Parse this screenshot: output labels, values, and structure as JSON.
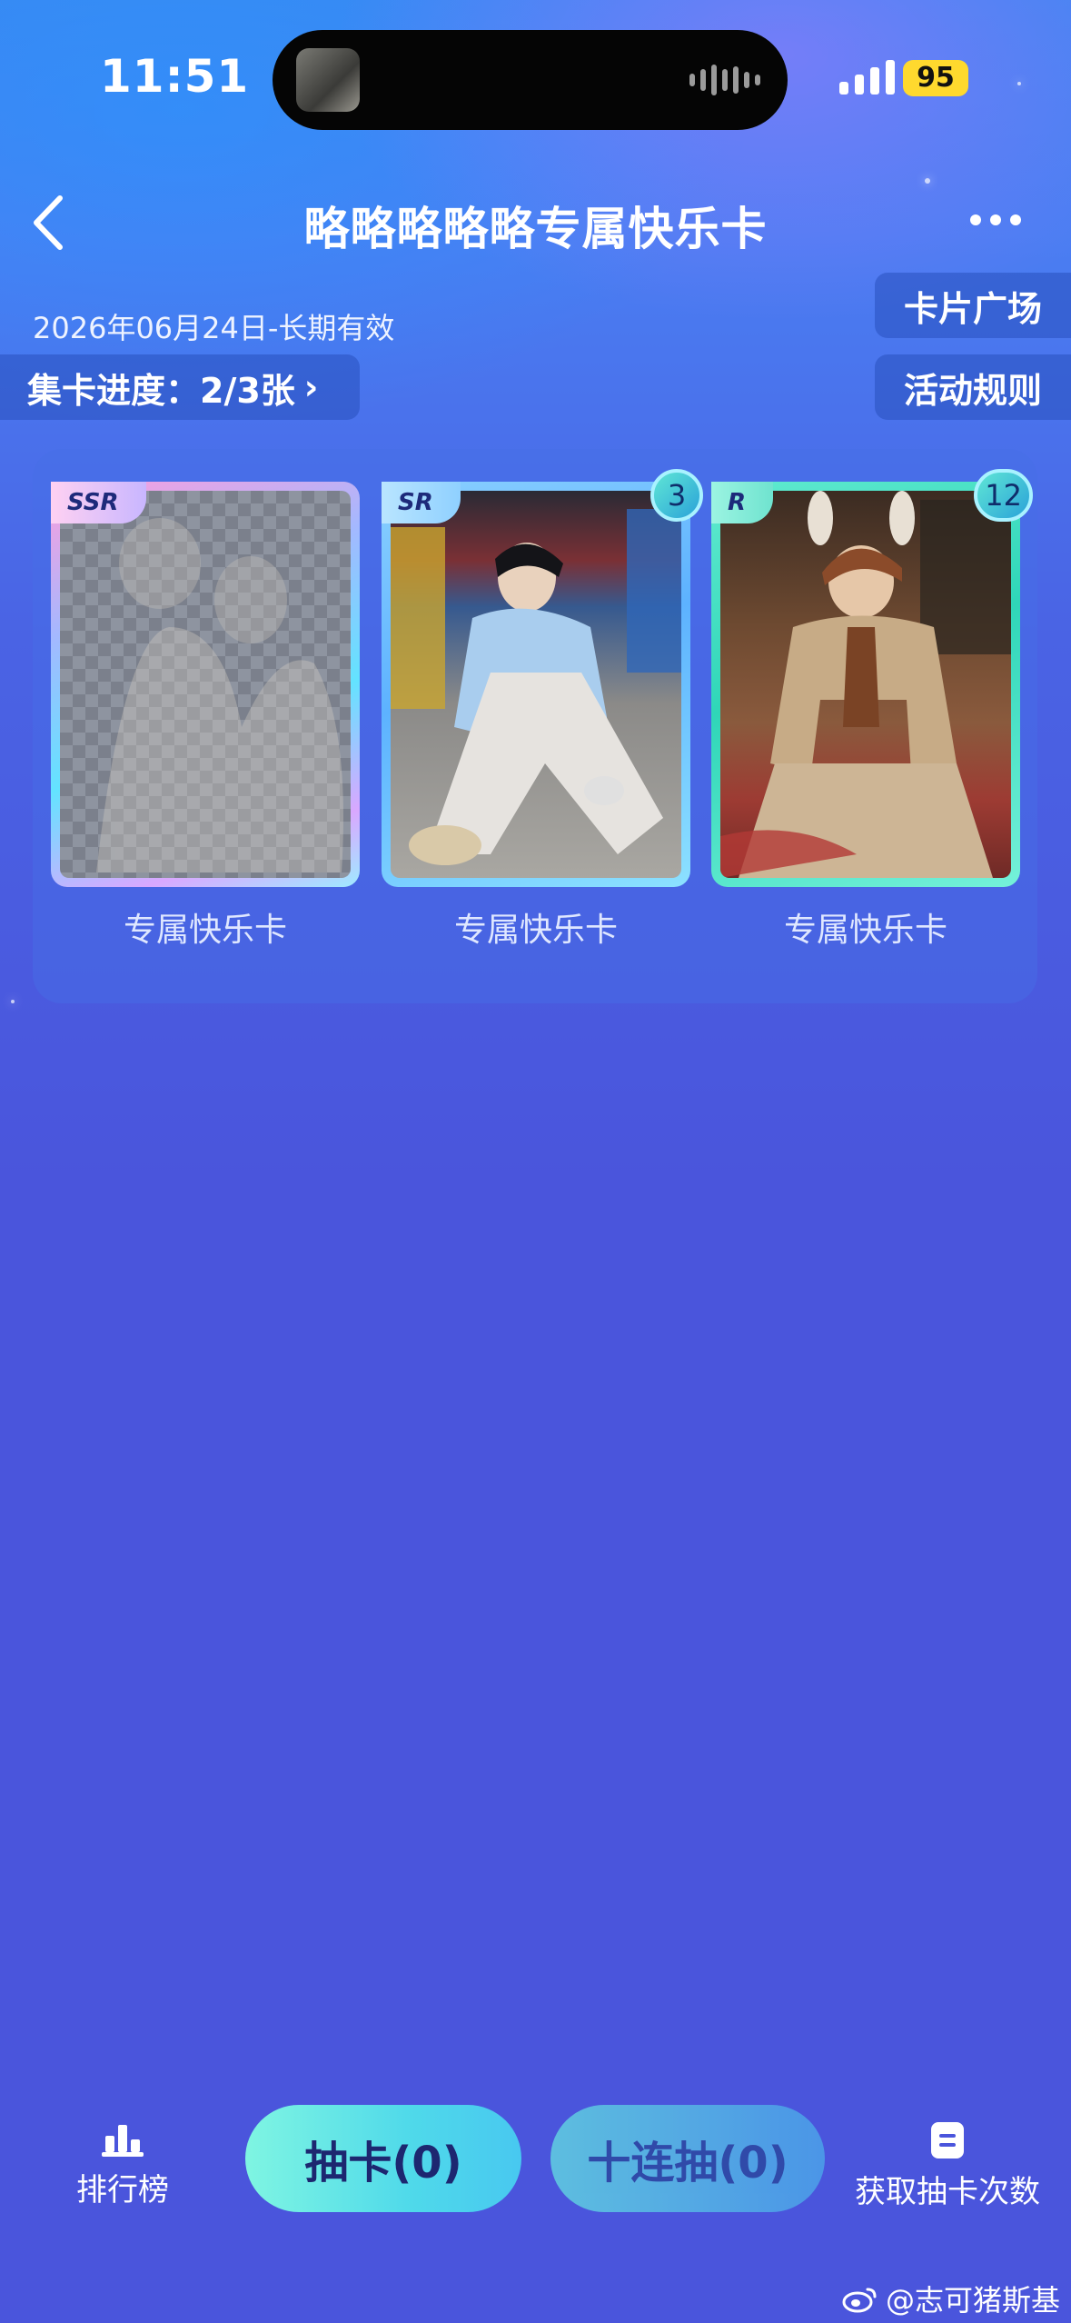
{
  "status_bar": {
    "time": "11:51",
    "battery": "95"
  },
  "header": {
    "title": "略略略略略专属快乐卡",
    "back_icon": "chevron-left-icon",
    "more_icon": "more-dots-icon"
  },
  "validity": "2026年06月24日-长期有效",
  "progress": {
    "label": "集卡进度：2/3张",
    "chevron": "›"
  },
  "side_buttons": {
    "square": "卡片广场",
    "rules": "活动规则"
  },
  "cards": [
    {
      "rarity": "SSR",
      "label": "专属快乐卡",
      "count": "",
      "locked": true
    },
    {
      "rarity": "SR",
      "label": "专属快乐卡",
      "count": "3",
      "locked": false
    },
    {
      "rarity": "R",
      "label": "专属快乐卡",
      "count": "12",
      "locked": false
    }
  ],
  "bottom_bar": {
    "ranking": "排行榜",
    "draw": "抽卡(0)",
    "ten_draw": "十连抽(0)",
    "get_chances": "获取抽卡次数"
  },
  "watermark": "@志可猪斯基"
}
